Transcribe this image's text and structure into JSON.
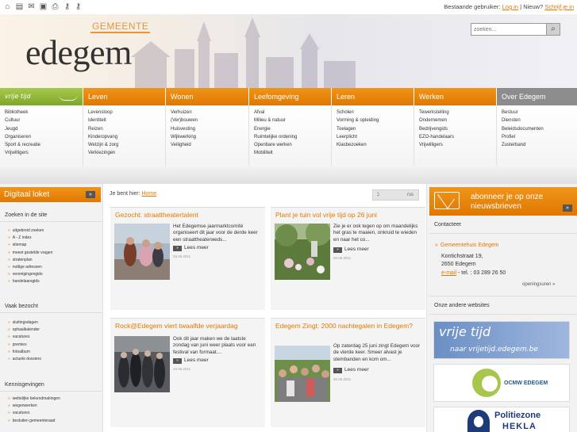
{
  "topbar": {
    "icons": [
      "home-icon",
      "printer-icon",
      "mail-icon",
      "lock-icon",
      "print-icon",
      "key-icon",
      "key2-icon"
    ],
    "existing_user": "Bestaande gebruiker:",
    "login": "Log in",
    "new_user": "Nieuw?",
    "register": "Schrijf je in"
  },
  "header": {
    "gemeente": "GEMEENTE",
    "brand": "edegem",
    "search_placeholder": "zoeken..."
  },
  "nav": {
    "vrij_tijd": "vrije tijd",
    "tabs": [
      "Leven",
      "Wonen",
      "Leefomgeving",
      "Leren",
      "Werken",
      "Over Edegem"
    ]
  },
  "megamenu": {
    "vrij_tijd": [
      "Bibliotheek",
      "Cultuur",
      "Jeugd",
      "Organiseren",
      "Sport & recreatie",
      "Vrijwilligers"
    ],
    "leven": [
      "Levensloop",
      "Identiteit",
      "Reizen",
      "Kinderopvang",
      "Welzijn & zorg",
      "Verkiezingen"
    ],
    "wonen": [
      "Verhuizen",
      "(Ver)bouwen",
      "Huisvesting",
      "Wijkwerking",
      "Veiligheid"
    ],
    "leefomgeving": [
      "Afval",
      "Milieu & natuur",
      "Energie",
      "Ruimtelijke ordening",
      "Openbare werken",
      "Mobiliteit"
    ],
    "leren": [
      "Scholen",
      "Vorming & opleiding",
      "Toelagen",
      "Leerplicht",
      "Klasbezoeken"
    ],
    "werken": [
      "Tewerkstelling",
      "Ondernemen",
      "Bedrijvengids",
      "EZO-handelaars",
      "Vrijwilligers"
    ],
    "over_edegem": [
      "Bestuur",
      "Diensten",
      "Beleidsdocumenten",
      "Profiel",
      "Zusterband"
    ]
  },
  "left": {
    "loket_title": "Digitaal loket",
    "search_head": "Zoeken in de site",
    "search_links": [
      "uitgebreid zoeken",
      "A - Z index",
      "sitemap",
      "meest gestelde vragen",
      "stratenplan",
      "nuttige adressen",
      "verenigingengids",
      "handelaarsgids"
    ],
    "visited_head": "Vaak bezocht",
    "visited_links": [
      "sluitingsdagen",
      "ophaalkalender",
      "vacatures",
      "premies",
      "fotoalbum",
      "actuele dossiers"
    ],
    "notices_head": "Kennisgevingen",
    "notices_links": [
      "wettelijke bekendmakingen",
      "wegenwerken",
      "vacatures",
      "besluiten gemeenteraad"
    ]
  },
  "breadcrumb": {
    "label": "Je bent hier:",
    "home": "Home"
  },
  "rss_label": "rss",
  "articles": [
    {
      "title": "Gezocht: straattheatertalent",
      "text": "Het Edegemse jaarmarktcomité organiseert dit jaar voor de derde keer een straattheaterweds...",
      "more": "Lees meer",
      "date": "03.06.2011"
    },
    {
      "title": "Plant je tuin vol vrije tijd op 26 juni",
      "text": "Zie je er ook tegen op om maandelijks het gras te maaien, onkruid te wieden en naar het co...",
      "more": "Lees meer",
      "date": "20.06.2011"
    },
    {
      "title": "Rock@Edegem viert twaalfde verjaardag",
      "text": "Ook dit jaar maken we de laatste zondag van juni weer plaats voor een festival van formaat....",
      "more": "Lees meer",
      "date": "23.06.2011"
    },
    {
      "title": "Edegem Zingt: 2000 nachtegalen in Edegem?",
      "text": "Op zaterdag 25 juni zingt Edegem voor de vierde keer. Smeer alvast je stembanden en kom om...",
      "more": "Lees meer",
      "date": "20.06.2011"
    }
  ],
  "right": {
    "newsletter": "abonneer je op onze nieuwsbrieven",
    "contact_head": "Contacteer",
    "contact_title": "Gemeentehuis Edegem",
    "address1": "Kontichstraat 19,",
    "address2": "2650 Edegem",
    "email": "e-mail",
    "phone": " - tel. : 03 289 26 50",
    "opening": "openingsuren »",
    "websites_head": "Onze andere websites",
    "vrijetijd_logo_1": "vrije tijd",
    "vrijetijd_logo_2": "naar vrijetijd.edegem.be",
    "ocmw_label": "OCMW EDEGEM",
    "politie_1": "Politiezone",
    "politie_2": "HEKLA"
  },
  "colors": {
    "accent": "#e07a00",
    "green": "#8bb233",
    "grey_tab": "#8c8c8c"
  }
}
